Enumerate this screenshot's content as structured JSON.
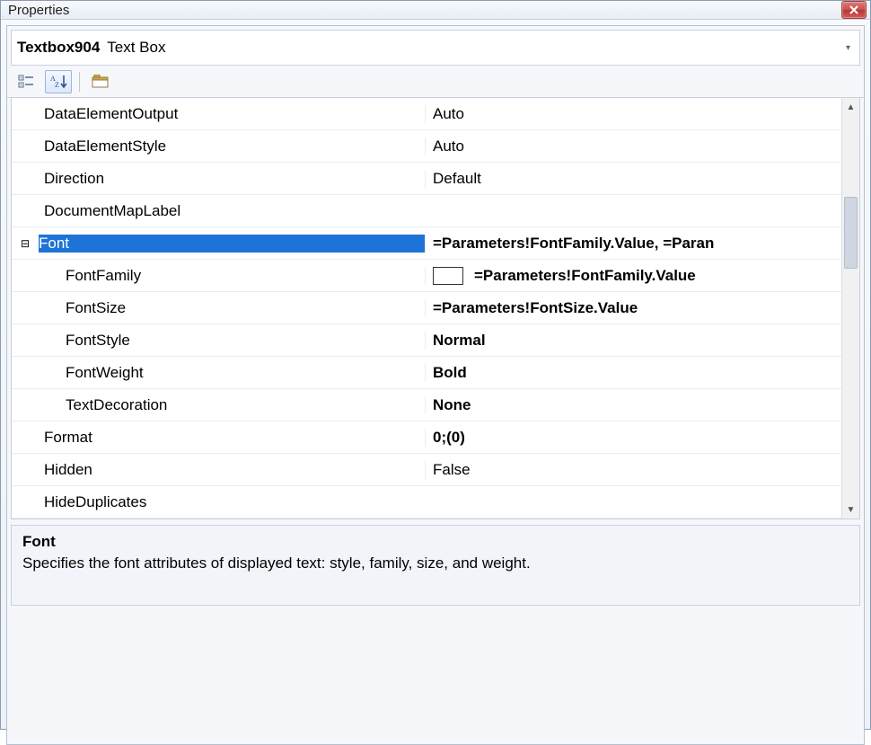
{
  "window": {
    "title": "Properties"
  },
  "object": {
    "name": "Textbox904",
    "type": "Text Box"
  },
  "properties": [
    {
      "expander": "",
      "indent": 1,
      "name": "DataElementOutput",
      "value": "Auto",
      "bold": false
    },
    {
      "expander": "",
      "indent": 1,
      "name": "DataElementStyle",
      "value": "Auto",
      "bold": false
    },
    {
      "expander": "",
      "indent": 1,
      "name": "Direction",
      "value": "Default",
      "bold": false
    },
    {
      "expander": "",
      "indent": 1,
      "name": "DocumentMapLabel",
      "value": "",
      "bold": false
    },
    {
      "expander": "⊟",
      "indent": 0,
      "name": "Font",
      "value": "=Parameters!FontFamily.Value, =Paran",
      "bold": true,
      "selected": true
    },
    {
      "expander": "",
      "indent": 2,
      "name": "FontFamily",
      "value": "=Parameters!FontFamily.Value",
      "bold": true,
      "swatch": true
    },
    {
      "expander": "",
      "indent": 2,
      "name": "FontSize",
      "value": "=Parameters!FontSize.Value",
      "bold": true
    },
    {
      "expander": "",
      "indent": 2,
      "name": "FontStyle",
      "value": "Normal",
      "bold": true
    },
    {
      "expander": "",
      "indent": 2,
      "name": "FontWeight",
      "value": "Bold",
      "bold": true
    },
    {
      "expander": "",
      "indent": 2,
      "name": "TextDecoration",
      "value": "None",
      "bold": true
    },
    {
      "expander": "",
      "indent": 1,
      "name": "Format",
      "value": "0;(0)",
      "bold": true
    },
    {
      "expander": "",
      "indent": 1,
      "name": "Hidden",
      "value": "False",
      "bold": false
    },
    {
      "expander": "",
      "indent": 1,
      "name": "HideDuplicates",
      "value": "",
      "bold": false
    }
  ],
  "description": {
    "title": "Font",
    "body": "Specifies the font attributes of displayed text: style, family, size, and weight."
  }
}
